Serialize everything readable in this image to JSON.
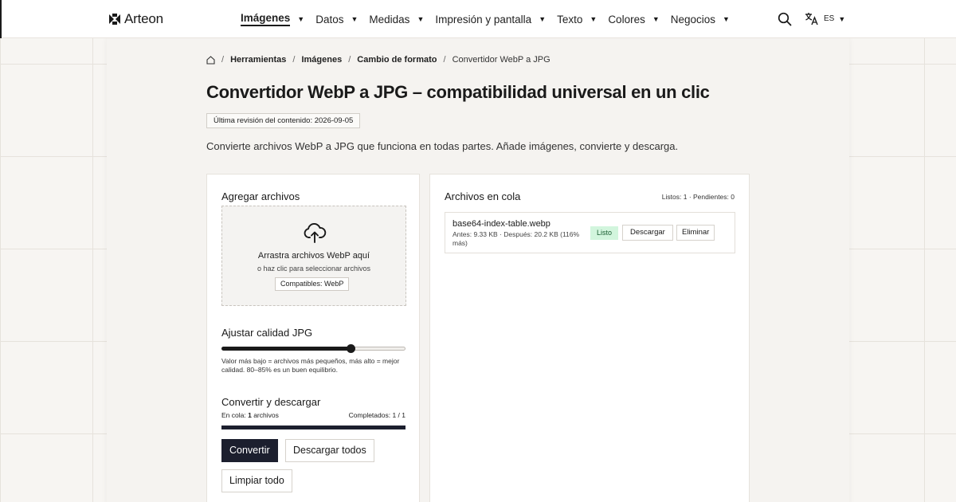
{
  "brand": {
    "name": "Arteon"
  },
  "nav": {
    "items": [
      {
        "label": "Imágenes",
        "active": true
      },
      {
        "label": "Datos"
      },
      {
        "label": "Medidas"
      },
      {
        "label": "Impresión y pantalla"
      },
      {
        "label": "Texto"
      },
      {
        "label": "Colores"
      },
      {
        "label": "Negocios"
      }
    ],
    "language": "ES"
  },
  "breadcrumb": {
    "items": [
      "Herramientas",
      "Imágenes",
      "Cambio de formato"
    ],
    "current": "Convertidor WebP a JPG"
  },
  "page": {
    "title": "Convertidor WebP a JPG – compatibilidad universal en un clic",
    "revision": "Última revisión del contenido: 2026-09-05",
    "intro": "Convierte archivos WebP a JPG que funciona en todas partes. Añade imágenes, convierte y descarga."
  },
  "upload": {
    "title": "Agregar archivos",
    "drop_text": "Arrastra archivos WebP aquí",
    "click_text": "o haz clic para seleccionar archivos",
    "compatible": "Compatibles: WebP"
  },
  "quality": {
    "title": "Ajustar calidad JPG",
    "value_fraction": 0.7,
    "hint": "Valor más bajo = archivos más pequeños, más alto = mejor calidad. 80–85% es un buen equilibrio."
  },
  "convert": {
    "title": "Convertir y descargar",
    "queued_prefix": "En cola:",
    "queued_count": "1",
    "queued_suffix": "archivos",
    "completed": "Completados: 1 / 1",
    "progress_fraction": 1.0,
    "convert_label": "Convertir",
    "download_all_label": "Descargar todos",
    "clear_label": "Limpiar todo"
  },
  "queue": {
    "title": "Archivos en cola",
    "status": "Listos: 1 · Pendientes: 0",
    "files": [
      {
        "name": "base64-index-table.webp",
        "meta": "Antes: 9.33 KB · Después: 20.2 KB (116% más)",
        "status": "Listo",
        "download_label": "Descargar",
        "remove_label": "Eliminar"
      }
    ]
  },
  "colors": {
    "accent": "#1c1f2e",
    "ready_bg": "#d2f5dd",
    "ready_text": "#1a5e32"
  }
}
